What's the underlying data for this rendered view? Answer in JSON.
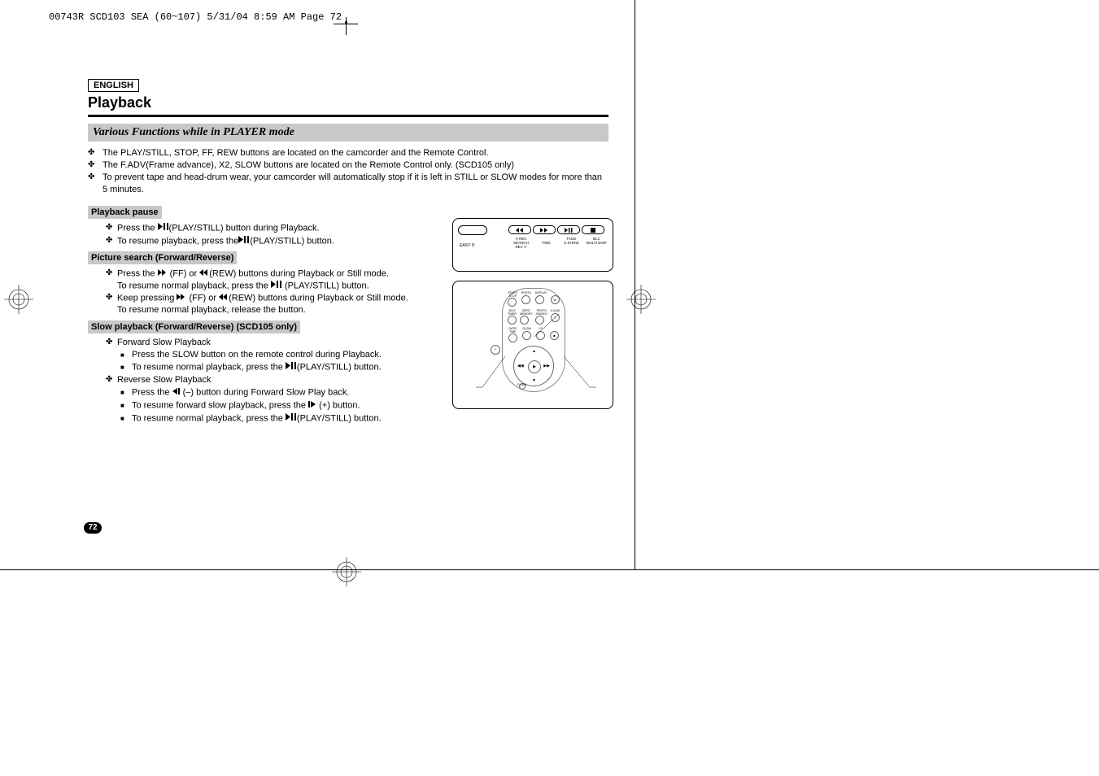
{
  "header": "00743R SCD103 SEA (60~107)  5/31/04 8:59 AM  Page 72",
  "lang": "ENGLISH",
  "title": "Playback",
  "subtitle": "Various Functions while in PLAYER mode",
  "intro": [
    "The PLAY/STILL, STOP, FF, REW buttons are located on the camcorder and the Remote Control.",
    "The F.ADV(Frame advance), X2, SLOW buttons are located on the Remote Control only. (SCD105 only)",
    "To prevent tape and head-drum wear, your camcorder will automatically stop if it is left in STILL or SLOW modes for more than 5 minutes."
  ],
  "sections": {
    "pause": {
      "head": "Playback pause",
      "b1a": "Press the ",
      "b1b": "(PLAY/STILL) button during Playback.",
      "b2a": "To resume playback, press the",
      "b2b": "(PLAY/STILL) button."
    },
    "search": {
      "head": "Picture search (Forward/Reverse)",
      "b1a": "Press the ",
      "b1b": " (FF) or ",
      "b1c": "(REW) buttons during Playback or Still mode.",
      "b1d": "To resume normal playback, press the ",
      "b1e": " (PLAY/STILL) button.",
      "b2a": "Keep pressing ",
      "b2b": " (FF) or ",
      "b2c": "(REW) buttons during Playback or Still mode.",
      "b2d": "To resume normal playback, release the button."
    },
    "slow": {
      "head": "Slow playback (Forward/Reverse) (SCD105 only)",
      "fwd": "Forward Slow Playback",
      "fwd1": "Press the SLOW button on the remote control during Playback.",
      "fwd2a": "To resume normal playback, press the ",
      "fwd2b": "(PLAY/STILL) button.",
      "rev": "Reverse Slow Playback",
      "rev1a": "Press the ",
      "rev1b": " (–) button during Forward Slow Play back.",
      "rev2a": "To resume forward slow playback, press the ",
      "rev2b": " (+) button.",
      "rev3a": "To resume normal playback, press the ",
      "rev3b": "(PLAY/STILL) button."
    }
  },
  "pageNum": "72",
  "panel": {
    "easy": "EASY",
    "labels": [
      "REC SEARCH\nREV",
      "\nFWD",
      "FADE\nS.SHOW",
      "BLC\nMULTI DISP."
    ]
  },
  "remote": {
    "r1": [
      "START/\nSTOP",
      "PHOTO",
      "DISPLAY",
      ""
    ],
    "r2": [
      "SELF\nTIMER",
      "ZERO\nMEMORY",
      "PHOTO\nSEARCH",
      "A.DUB"
    ],
    "r3": [
      "DATE/\nTIME",
      "SLOW",
      "X2",
      ""
    ],
    "fadv": "F.ADV"
  }
}
